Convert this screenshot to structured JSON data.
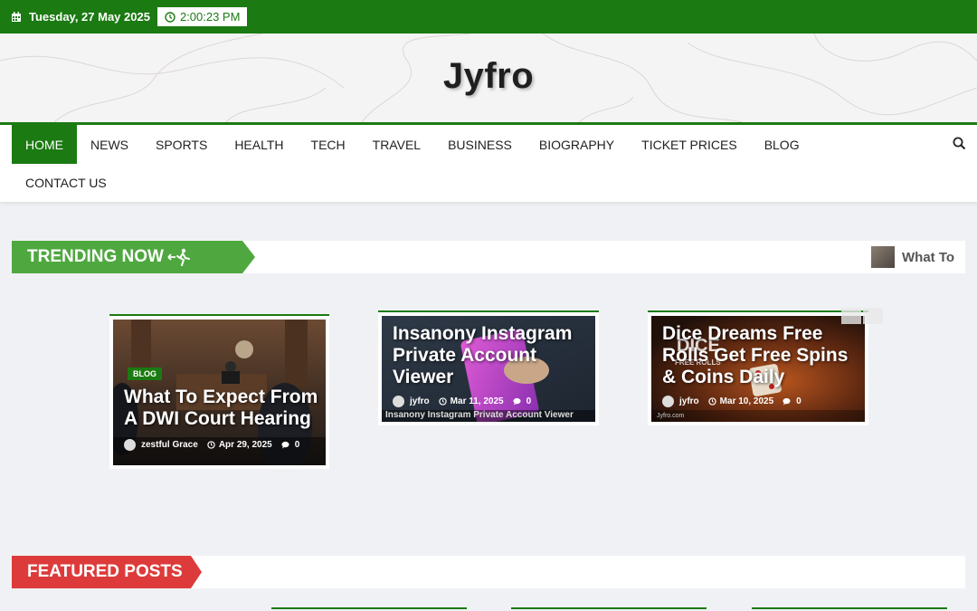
{
  "topbar": {
    "date": "Tuesday, 27 May 2025",
    "time": "2:00:23 PM",
    "bg_color": "#1b7a12"
  },
  "header": {
    "site_title": "Jyfro"
  },
  "nav": {
    "row1": [
      "HOME",
      "NEWS",
      "SPORTS",
      "HEALTH",
      "TECH",
      "TRAVEL",
      "BUSINESS",
      "BIOGRAPHY",
      "TICKET PRICES",
      "BLOG"
    ],
    "row2": [
      "CONTACT US"
    ],
    "active": "HOME",
    "search_icon": "search-icon"
  },
  "trending": {
    "label": "TRENDING NOW",
    "icon": "running-person-icon",
    "ticker_text": "What To Expect From A DWI Court Hearing",
    "color": "#4fa83f"
  },
  "slides": [
    {
      "category": "BLOG",
      "title": "What To Expect From A DWI Court Hearing",
      "author": "zestful Grace",
      "date": "Apr 29, 2025",
      "comments": "0"
    },
    {
      "title": "Insanony Instagram Private Account Viewer",
      "author": "jyfro",
      "date": "Mar 11, 2025",
      "comments": "0",
      "image_caption": "Insanony Instagram Private Account Viewer"
    },
    {
      "title": "Dice Dreams Free Rolls Get Free Spins & Coins Daily",
      "author": "jyfro",
      "date": "Mar 10, 2025",
      "comments": "0",
      "image_text": "DICE",
      "image_subtext": "FREE ROLLS",
      "image_watermark": "Jyfro.com"
    }
  ],
  "featured": {
    "label": "FEATURED POSTS",
    "color": "#dd3b3b"
  }
}
